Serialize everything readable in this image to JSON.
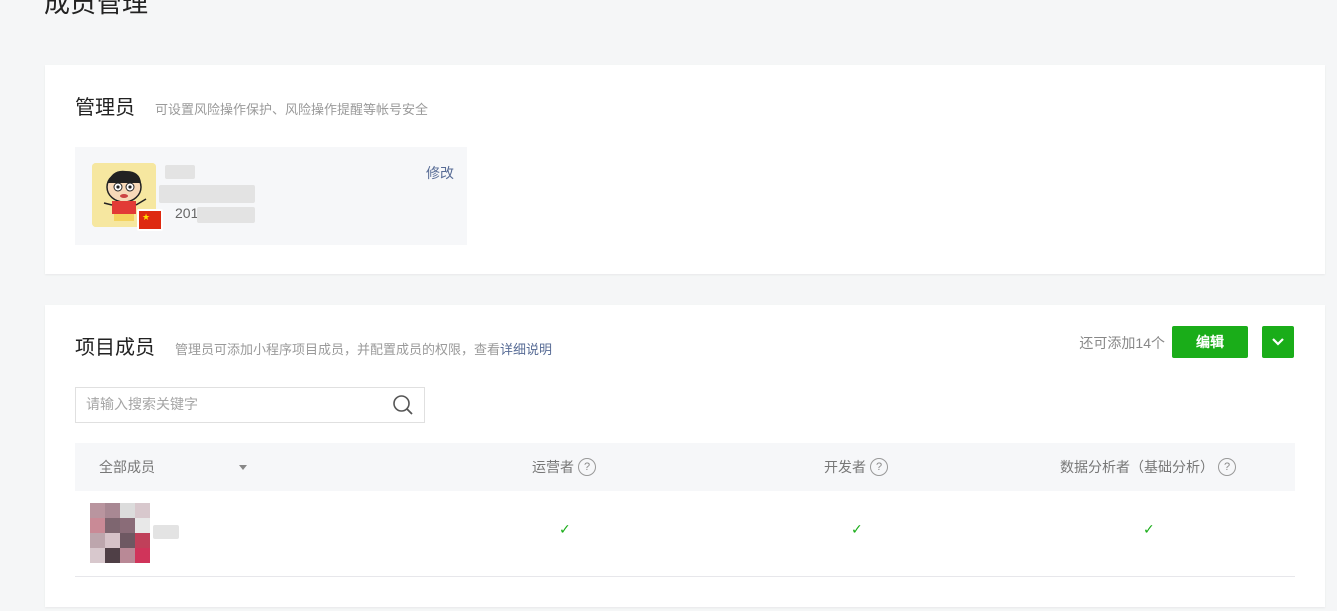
{
  "page": {
    "title": "成员管理"
  },
  "admin_section": {
    "title": "管理员",
    "description": "可设置风险操作保护、风险操作提醒等帐号安全",
    "admin": {
      "id_partial": "201",
      "edit_label": "修改"
    }
  },
  "members_section": {
    "title": "项目成员",
    "description": "管理员可添加小程序项目成员，并配置成员的权限，查看",
    "detail_link": "详细说明",
    "quota": "还可添加14个",
    "edit_button": "编辑",
    "search": {
      "placeholder": "请输入搜索关键字",
      "value": ""
    },
    "columns": {
      "member": "全部成员",
      "operator": "运营者",
      "developer": "开发者",
      "analyst": "数据分析者（基础分析）"
    },
    "rows": [
      {
        "operator": "✓",
        "developer": "✓",
        "analyst": "✓"
      }
    ]
  },
  "colors": {
    "accent": "#1aad19",
    "link": "#576b95"
  },
  "icons": {
    "search": "search-icon",
    "help": "question-circle-icon",
    "dropdown": "caret-down-icon",
    "more": "chevron-down-icon",
    "check": "check-icon"
  }
}
